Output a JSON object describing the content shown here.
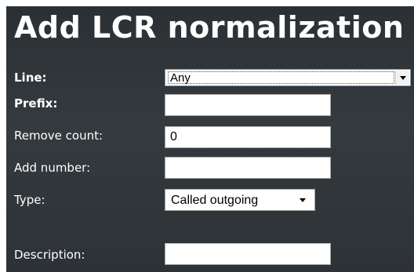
{
  "dialog": {
    "title": "Add LCR normalization"
  },
  "fields": {
    "line": {
      "label": "Line:",
      "value": "Any"
    },
    "prefix": {
      "label": "Prefix:",
      "value": ""
    },
    "remove_count": {
      "label": "Remove count:",
      "value": "0"
    },
    "add_number": {
      "label": "Add number:",
      "value": ""
    },
    "type": {
      "label": "Type:",
      "value": "Called outgoing"
    },
    "description": {
      "label": "Description:",
      "value": ""
    }
  },
  "icons": {
    "dropdown": "chevron-down-icon"
  },
  "colors": {
    "panel_background": "#30363a",
    "text": "#ffffff",
    "field_background": "#ffffff"
  }
}
